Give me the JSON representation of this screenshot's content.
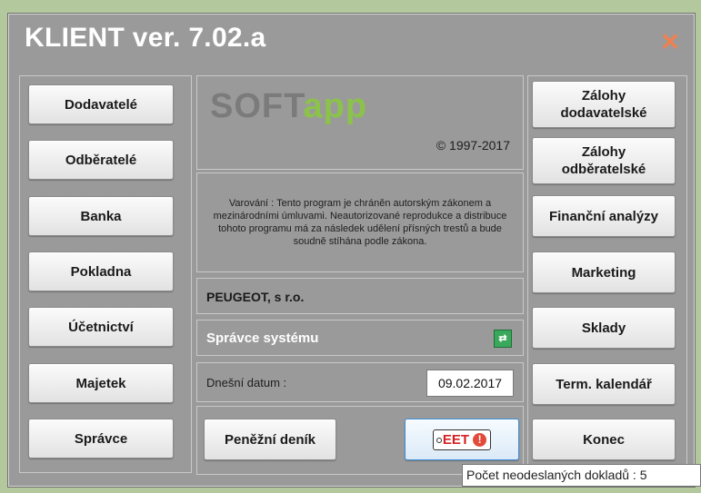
{
  "window": {
    "title": "KLIENT ver. 7.02.a",
    "close_icon": "close-x-icon"
  },
  "left_buttons": [
    {
      "label": "Dodavatelé"
    },
    {
      "label": "Odběratelé"
    },
    {
      "label": "Banka"
    },
    {
      "label": "Pokladna"
    },
    {
      "label": "Účetnictví"
    },
    {
      "label": "Majetek"
    },
    {
      "label": "Správce"
    }
  ],
  "right_buttons": [
    {
      "line1": "Zálohy",
      "line2": "dodavatelské"
    },
    {
      "line1": "Zálohy",
      "line2": "odběratelské"
    },
    {
      "label": "Finanční analýzy"
    },
    {
      "label": "Marketing"
    },
    {
      "label": "Sklady"
    },
    {
      "label": "Term. kalendář"
    },
    {
      "label": "Konec"
    }
  ],
  "center": {
    "logo_soft": "SOFT",
    "logo_app": "app",
    "copyright": "© 1997-2017",
    "warning": "Varování : Tento program je chráněn autorským zákonem a mezinárodními úmluvami. Neautorizované reprodukce a distribuce tohoto programu má za následek udělení přísných trestů a bude soudně stíhána podle zákona.",
    "company": "PEUGEOT, s r.o.",
    "user": "Správce systému",
    "date_label": "Dnešní datum :",
    "date_value": "09.02.2017",
    "cash_journal": "Peněžní deník",
    "eet_label": "EET"
  },
  "tooltip": "Počet neodeslaných dokladů : 5",
  "colors": {
    "window_bg": "#9a9a9a",
    "logo_green": "#8bc34a",
    "close_orange": "#f08050",
    "eet_red": "#d62020",
    "eet_border": "#3b8ed8"
  }
}
